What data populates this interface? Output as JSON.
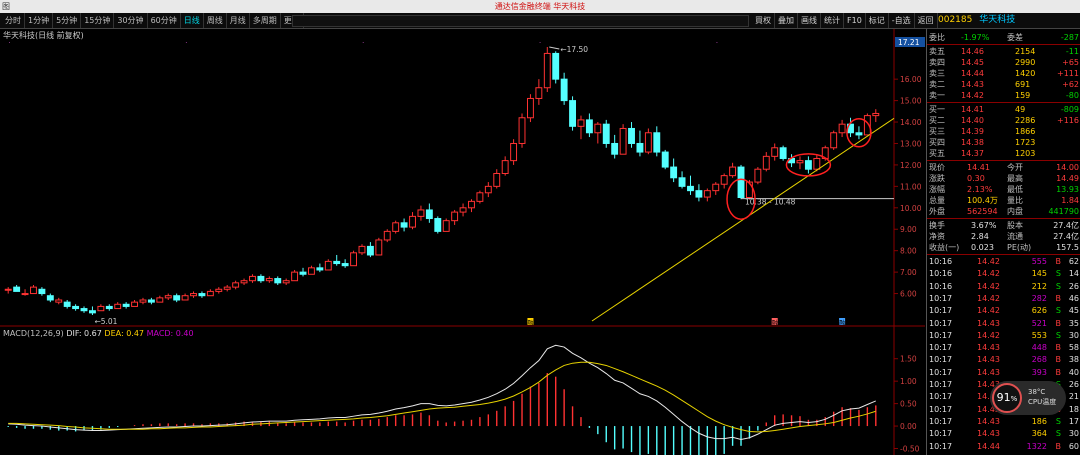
{
  "window": {
    "title": "通达信金融终端 华天科技",
    "sys_icon": "图"
  },
  "periods": [
    "分时",
    "1分钟",
    "5分钟",
    "15分钟",
    "30分钟",
    "60分钟",
    "日线",
    "周线",
    "月线",
    "多周期",
    "更多"
  ],
  "active_period": "日线",
  "right_buttons": [
    "買权",
    "叠加",
    "画线",
    "统计",
    "F10",
    "标记",
    "-自选",
    "返回"
  ],
  "stock": {
    "code": "002185",
    "name": "华天科技"
  },
  "chart": {
    "title": "华天科技(日线 前复权)",
    "high_label": "17.50",
    "low_label": "5.01",
    "range_label": "10.38 - 10.48",
    "current_price_label": "17.21",
    "price_ticks": [
      "16.00",
      "15.00",
      "14.00",
      "13.00",
      "12.00",
      "11.00",
      "10.00",
      "9.00",
      "8.00",
      "7.00",
      "6.00"
    ],
    "macd_ticks": [
      "1.50",
      "1.00",
      "0.50",
      "0.00",
      "-0.50"
    ],
    "event_markers": [
      "融",
      "融",
      "融"
    ],
    "macd": {
      "label": "MACD(12,26,9)",
      "dif": "DIF: 0.67",
      "dea": "DEA: 0.47",
      "macd": "MACD: 0.40"
    }
  },
  "chart_data": {
    "type": "candlestick",
    "ylim": [
      5.0,
      17.5
    ],
    "candles": [
      [
        6.2,
        6.3,
        6.0,
        6.2
      ],
      [
        6.3,
        6.4,
        6.1,
        6.1
      ],
      [
        6.0,
        6.2,
        5.9,
        6.0
      ],
      [
        6.0,
        6.4,
        6.0,
        6.3
      ],
      [
        6.2,
        6.3,
        5.9,
        6.0
      ],
      [
        5.9,
        6.0,
        5.6,
        5.7
      ],
      [
        5.6,
        5.8,
        5.5,
        5.7
      ],
      [
        5.6,
        5.7,
        5.3,
        5.4
      ],
      [
        5.4,
        5.5,
        5.2,
        5.3
      ],
      [
        5.3,
        5.4,
        5.1,
        5.2
      ],
      [
        5.2,
        5.4,
        5.0,
        5.1
      ],
      [
        5.2,
        5.5,
        5.2,
        5.4
      ],
      [
        5.4,
        5.5,
        5.2,
        5.3
      ],
      [
        5.3,
        5.6,
        5.3,
        5.5
      ],
      [
        5.5,
        5.6,
        5.3,
        5.4
      ],
      [
        5.4,
        5.7,
        5.4,
        5.6
      ],
      [
        5.6,
        5.8,
        5.5,
        5.7
      ],
      [
        5.7,
        5.8,
        5.5,
        5.6
      ],
      [
        5.6,
        5.9,
        5.6,
        5.8
      ],
      [
        5.8,
        6.0,
        5.7,
        5.9
      ],
      [
        5.9,
        6.0,
        5.6,
        5.7
      ],
      [
        5.7,
        6.0,
        5.7,
        5.9
      ],
      [
        5.9,
        6.1,
        5.8,
        6.0
      ],
      [
        6.0,
        6.1,
        5.8,
        5.9
      ],
      [
        5.9,
        6.2,
        5.9,
        6.1
      ],
      [
        6.1,
        6.3,
        6.0,
        6.2
      ],
      [
        6.2,
        6.4,
        6.1,
        6.3
      ],
      [
        6.3,
        6.6,
        6.2,
        6.5
      ],
      [
        6.5,
        6.7,
        6.4,
        6.6
      ],
      [
        6.6,
        6.9,
        6.5,
        6.8
      ],
      [
        6.8,
        6.9,
        6.5,
        6.6
      ],
      [
        6.6,
        6.8,
        6.5,
        6.7
      ],
      [
        6.7,
        6.8,
        6.4,
        6.5
      ],
      [
        6.5,
        6.7,
        6.4,
        6.6
      ],
      [
        6.6,
        7.1,
        6.6,
        7.0
      ],
      [
        7.0,
        7.2,
        6.8,
        6.9
      ],
      [
        6.9,
        7.3,
        6.9,
        7.2
      ],
      [
        7.2,
        7.4,
        7.0,
        7.1
      ],
      [
        7.1,
        7.6,
        7.1,
        7.5
      ],
      [
        7.5,
        7.8,
        7.3,
        7.4
      ],
      [
        7.4,
        7.6,
        7.2,
        7.3
      ],
      [
        7.3,
        8.0,
        7.3,
        7.9
      ],
      [
        7.9,
        8.3,
        7.8,
        8.2
      ],
      [
        8.2,
        8.4,
        7.7,
        7.8
      ],
      [
        7.8,
        8.6,
        7.8,
        8.5
      ],
      [
        8.5,
        9.0,
        8.4,
        8.9
      ],
      [
        8.9,
        9.4,
        8.8,
        9.3
      ],
      [
        9.3,
        9.5,
        8.9,
        9.1
      ],
      [
        9.1,
        9.8,
        9.0,
        9.6
      ],
      [
        9.6,
        10.1,
        9.4,
        9.9
      ],
      [
        9.9,
        10.2,
        9.3,
        9.5
      ],
      [
        9.5,
        9.6,
        8.8,
        8.9
      ],
      [
        8.9,
        9.5,
        8.9,
        9.4
      ],
      [
        9.4,
        9.9,
        9.2,
        9.8
      ],
      [
        9.8,
        10.2,
        9.6,
        10.0
      ],
      [
        10.0,
        10.4,
        9.8,
        10.3
      ],
      [
        10.3,
        10.8,
        10.2,
        10.7
      ],
      [
        10.7,
        11.2,
        10.5,
        11.0
      ],
      [
        11.0,
        11.8,
        10.9,
        11.6
      ],
      [
        11.6,
        12.4,
        11.5,
        12.2
      ],
      [
        12.2,
        13.2,
        12.0,
        13.0
      ],
      [
        13.0,
        14.4,
        12.8,
        14.2
      ],
      [
        14.2,
        15.3,
        14.0,
        15.1
      ],
      [
        15.1,
        16.0,
        14.8,
        15.6
      ],
      [
        15.6,
        17.5,
        15.4,
        17.2
      ],
      [
        17.2,
        17.3,
        15.8,
        16.0
      ],
      [
        16.0,
        16.3,
        14.8,
        15.0
      ],
      [
        15.0,
        15.2,
        13.6,
        13.8
      ],
      [
        13.8,
        14.3,
        13.2,
        14.1
      ],
      [
        14.1,
        14.4,
        13.3,
        13.5
      ],
      [
        13.5,
        14.0,
        13.0,
        13.9
      ],
      [
        13.9,
        14.1,
        12.8,
        13.0
      ],
      [
        13.0,
        13.4,
        12.3,
        12.5
      ],
      [
        12.5,
        13.9,
        12.5,
        13.7
      ],
      [
        13.7,
        14.0,
        12.8,
        13.0
      ],
      [
        13.0,
        13.6,
        12.4,
        12.6
      ],
      [
        12.6,
        13.7,
        12.5,
        13.5
      ],
      [
        13.5,
        13.8,
        12.4,
        12.6
      ],
      [
        12.6,
        12.7,
        11.8,
        11.9
      ],
      [
        11.9,
        12.3,
        11.2,
        11.4
      ],
      [
        11.4,
        11.7,
        10.9,
        11.0
      ],
      [
        11.0,
        11.5,
        10.6,
        10.8
      ],
      [
        10.8,
        11.1,
        10.3,
        10.5
      ],
      [
        10.5,
        10.9,
        10.3,
        10.8
      ],
      [
        10.8,
        11.2,
        10.6,
        11.1
      ],
      [
        11.1,
        11.6,
        10.9,
        11.5
      ],
      [
        11.5,
        12.1,
        11.4,
        11.9
      ],
      [
        11.9,
        12.0,
        10.4,
        10.48
      ],
      [
        10.48,
        11.3,
        10.38,
        11.2
      ],
      [
        11.2,
        11.9,
        11.1,
        11.8
      ],
      [
        11.8,
        12.6,
        11.7,
        12.4
      ],
      [
        12.4,
        13.0,
        12.2,
        12.8
      ],
      [
        12.8,
        12.9,
        12.2,
        12.3
      ],
      [
        12.3,
        12.5,
        11.9,
        12.1
      ],
      [
        12.1,
        12.4,
        11.8,
        12.2
      ],
      [
        12.2,
        12.4,
        11.6,
        11.8
      ],
      [
        11.8,
        12.5,
        11.7,
        12.3
      ],
      [
        12.3,
        12.9,
        12.2,
        12.8
      ],
      [
        12.8,
        13.6,
        12.7,
        13.5
      ],
      [
        13.5,
        14.1,
        13.3,
        13.9
      ],
      [
        13.9,
        14.2,
        13.3,
        13.5
      ],
      [
        13.5,
        13.8,
        13.2,
        13.4
      ],
      [
        13.4,
        14.4,
        13.4,
        14.3
      ],
      [
        14.3,
        14.6,
        14.0,
        14.4
      ]
    ],
    "macd": {
      "dif": [
        0.05,
        0.04,
        0.02,
        0.01,
        0.0,
        -0.02,
        -0.04,
        -0.06,
        -0.08,
        -0.09,
        -0.1,
        -0.1,
        -0.09,
        -0.08,
        -0.07,
        -0.06,
        -0.05,
        -0.04,
        -0.03,
        -0.02,
        -0.02,
        -0.01,
        0.0,
        0.0,
        0.01,
        0.02,
        0.03,
        0.05,
        0.07,
        0.09,
        0.1,
        0.11,
        0.11,
        0.11,
        0.13,
        0.14,
        0.15,
        0.16,
        0.18,
        0.19,
        0.19,
        0.22,
        0.25,
        0.26,
        0.29,
        0.33,
        0.38,
        0.41,
        0.45,
        0.5,
        0.5,
        0.46,
        0.45,
        0.47,
        0.5,
        0.53,
        0.58,
        0.64,
        0.72,
        0.82,
        0.95,
        1.12,
        1.3,
        1.46,
        1.72,
        1.8,
        1.76,
        1.62,
        1.52,
        1.4,
        1.3,
        1.17,
        1.02,
        0.96,
        0.84,
        0.72,
        0.66,
        0.56,
        0.42,
        0.26,
        0.1,
        -0.04,
        -0.16,
        -0.24,
        -0.28,
        -0.28,
        -0.25,
        -0.3,
        -0.26,
        -0.18,
        -0.08,
        0.02,
        0.06,
        0.08,
        0.1,
        0.08,
        0.1,
        0.15,
        0.24,
        0.34,
        0.38,
        0.4,
        0.48,
        0.56
      ],
      "dea": [
        0.06,
        0.06,
        0.05,
        0.04,
        0.03,
        0.02,
        0.01,
        -0.01,
        -0.02,
        -0.04,
        -0.05,
        -0.06,
        -0.07,
        -0.07,
        -0.07,
        -0.07,
        -0.07,
        -0.06,
        -0.06,
        -0.05,
        -0.04,
        -0.04,
        -0.03,
        -0.02,
        -0.02,
        -0.01,
        0.0,
        0.01,
        0.02,
        0.04,
        0.05,
        0.06,
        0.07,
        0.08,
        0.09,
        0.1,
        0.11,
        0.12,
        0.13,
        0.14,
        0.15,
        0.16,
        0.18,
        0.19,
        0.21,
        0.23,
        0.26,
        0.29,
        0.32,
        0.35,
        0.38,
        0.4,
        0.41,
        0.42,
        0.44,
        0.46,
        0.48,
        0.51,
        0.55,
        0.6,
        0.67,
        0.76,
        0.86,
        0.98,
        1.13,
        1.25,
        1.35,
        1.4,
        1.42,
        1.42,
        1.39,
        1.35,
        1.28,
        1.21,
        1.13,
        1.05,
        0.97,
        0.89,
        0.8,
        0.69,
        0.57,
        0.45,
        0.33,
        0.21,
        0.11,
        0.03,
        -0.03,
        -0.08,
        -0.12,
        -0.13,
        -0.12,
        -0.1,
        -0.07,
        -0.04,
        -0.01,
        0.01,
        0.03,
        0.05,
        0.08,
        0.13,
        0.18,
        0.22,
        0.27,
        0.33
      ]
    }
  },
  "quote_panel": {
    "commission": {
      "label": "委比",
      "ratio": "-1.97%",
      "diff_label": "委差",
      "diff": "-287"
    },
    "asks": [
      {
        "label": "卖五",
        "price": "14.46",
        "vol": "2154",
        "chg": "-11"
      },
      {
        "label": "卖四",
        "price": "14.45",
        "vol": "2990",
        "chg": "+65"
      },
      {
        "label": "卖三",
        "price": "14.44",
        "vol": "1420",
        "chg": "+111"
      },
      {
        "label": "卖二",
        "price": "14.43",
        "vol": "691",
        "chg": "+62"
      },
      {
        "label": "卖一",
        "price": "14.42",
        "vol": "159",
        "chg": "-80"
      }
    ],
    "bids": [
      {
        "label": "买一",
        "price": "14.41",
        "vol": "49",
        "chg": "-809"
      },
      {
        "label": "买二",
        "price": "14.40",
        "vol": "2286",
        "chg": "+116"
      },
      {
        "label": "买三",
        "price": "14.39",
        "vol": "1866",
        "chg": ""
      },
      {
        "label": "买四",
        "price": "14.38",
        "vol": "1723",
        "chg": ""
      },
      {
        "label": "买五",
        "price": "14.37",
        "vol": "1203",
        "chg": ""
      }
    ],
    "stats": [
      {
        "l1": "现价",
        "v1": "14.41",
        "l2": "今开",
        "v2": "14.00"
      },
      {
        "l1": "涨跌",
        "v1": "0.30",
        "l2": "最高",
        "v2": "14.49"
      },
      {
        "l1": "涨幅",
        "v1": "2.13%",
        "l2": "最低",
        "v2": "13.93"
      },
      {
        "l1": "总量",
        "v1": "100.4万",
        "l2": "量比",
        "v2": "1.84"
      },
      {
        "l1": "外盘",
        "v1": "562594",
        "l2": "内盘",
        "v2": "441790"
      }
    ],
    "stats2": [
      {
        "l1": "换手",
        "v1": "3.67%",
        "l2": "股本",
        "v2": "27.4亿"
      },
      {
        "l1": "净资",
        "v1": "2.84",
        "l2": "流通",
        "v2": "27.4亿"
      },
      {
        "l1": "收益(一)",
        "v1": "0.023",
        "l2": "PE(动)",
        "v2": "157.5"
      }
    ],
    "ticks": [
      {
        "t": "10:16",
        "p": "14.42",
        "v": "555",
        "bs": "B",
        "n": "62"
      },
      {
        "t": "10:16",
        "p": "14.42",
        "v": "145",
        "bs": "S",
        "n": "14"
      },
      {
        "t": "10:16",
        "p": "14.42",
        "v": "212",
        "bs": "S",
        "n": "26"
      },
      {
        "t": "10:17",
        "p": "14.42",
        "v": "282",
        "bs": "B",
        "n": "46"
      },
      {
        "t": "10:17",
        "p": "14.42",
        "v": "626",
        "bs": "S",
        "n": "45"
      },
      {
        "t": "10:17",
        "p": "14.43",
        "v": "521",
        "bs": "B",
        "n": "35"
      },
      {
        "t": "10:17",
        "p": "14.42",
        "v": "553",
        "bs": "S",
        "n": "30"
      },
      {
        "t": "10:17",
        "p": "14.43",
        "v": "448",
        "bs": "B",
        "n": "58"
      },
      {
        "t": "10:17",
        "p": "14.43",
        "v": "268",
        "bs": "B",
        "n": "38"
      },
      {
        "t": "10:17",
        "p": "14.43",
        "v": "393",
        "bs": "B",
        "n": "40"
      },
      {
        "t": "10:17",
        "p": "14.43",
        "v": "475",
        "bs": "S",
        "n": "26"
      },
      {
        "t": "10:17",
        "p": "14.43",
        "v": "112",
        "bs": "B",
        "n": "21"
      },
      {
        "t": "10:17",
        "p": "14.43",
        "v": "304",
        "bs": "B",
        "n": "18"
      },
      {
        "t": "10:17",
        "p": "14.43",
        "v": "186",
        "bs": "S",
        "n": "17"
      },
      {
        "t": "10:17",
        "p": "14.43",
        "v": "364",
        "bs": "S",
        "n": "30"
      },
      {
        "t": "10:17",
        "p": "14.44",
        "v": "1322",
        "bs": "B",
        "n": "60"
      }
    ]
  },
  "cpu_widget": {
    "percent": "91",
    "unit": "%",
    "temp": "38°C",
    "label": "CPU温度"
  }
}
